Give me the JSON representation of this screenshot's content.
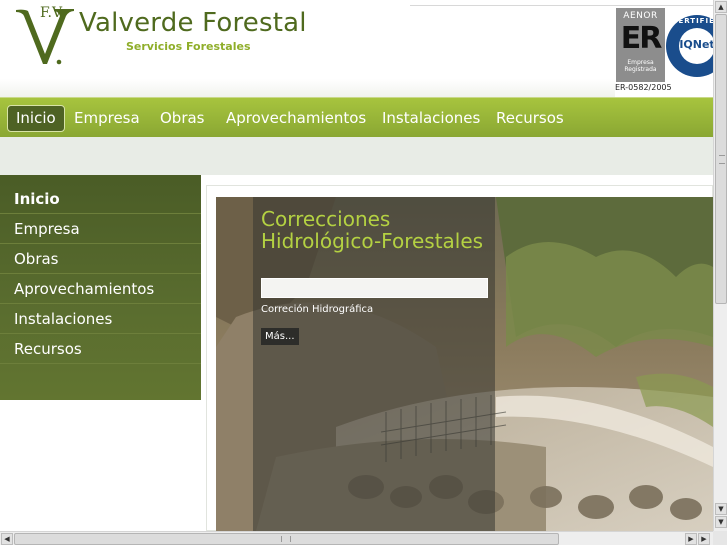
{
  "site": {
    "monogram": "F.V.",
    "name": "Valverde Forestal",
    "tagline": "Servicios Forestales"
  },
  "certifications": {
    "aenor": {
      "label": "AENOR",
      "mark": "ER",
      "caption": "Empresa Registrada",
      "number": "ER-0582/2005"
    },
    "iqnet": {
      "ring_text": "CERTIFIED",
      "label": "IQNet"
    }
  },
  "nav": {
    "active": "Inicio",
    "items": [
      "Inicio",
      "Empresa",
      "Obras",
      "Aprovechamientos",
      "Instalaciones",
      "Recursos"
    ]
  },
  "sidebar": {
    "active": "Inicio",
    "items": [
      "Inicio",
      "Empresa",
      "Obras",
      "Aprovechamientos",
      "Instalaciones",
      "Recursos"
    ]
  },
  "slide": {
    "title": "Correcciones Hidrológico-Forestales",
    "description": "Correción Hidrográfica",
    "more_label": "Más..."
  },
  "colors": {
    "brand_green": "#8aa733",
    "dark_green": "#4e6224",
    "title_green": "#b4d142",
    "logo_green": "#4f6a1e"
  },
  "icons": {
    "scroll_up": "triangle-up-icon",
    "scroll_down": "triangle-down-icon",
    "scroll_left": "triangle-left-icon",
    "scroll_right": "triangle-right-icon"
  }
}
